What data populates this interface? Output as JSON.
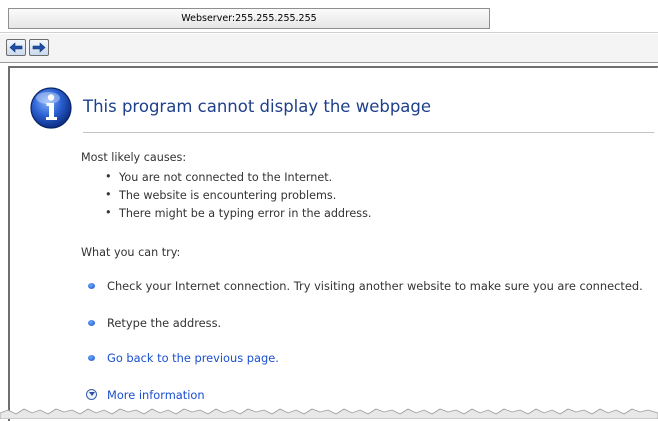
{
  "window": {
    "title": "Webserver:255.255.255.255"
  },
  "toolbar": {
    "back_icon": "arrow-left-icon",
    "forward_icon": "arrow-right-icon"
  },
  "page": {
    "heading": "This program cannot display the webpage",
    "causes_title": "Most likely causes:",
    "causes": [
      "You are not connected to the Internet.",
      "The website is encountering problems.",
      "There might be a typing error in the address."
    ],
    "try_title": "What you can try:",
    "actions": [
      "Check your Internet connection. Try visiting another website to make sure you are connected.",
      "Retype the address.",
      "Go back to the previous page."
    ],
    "more_info": "More information"
  },
  "colors": {
    "heading": "#1e3f8a",
    "link": "#1a4fd0",
    "text": "#333333"
  }
}
